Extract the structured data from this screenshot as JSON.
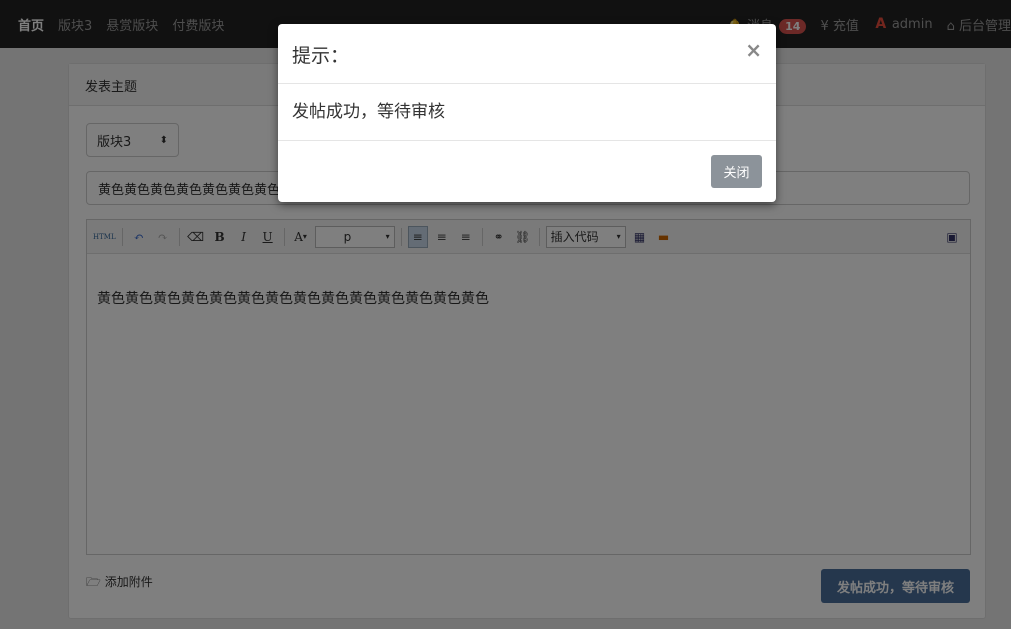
{
  "nav": {
    "home": "首页",
    "board3": "版块3",
    "reward": "悬赏版块",
    "paid": "付费版块",
    "messages": "消息",
    "message_count": "14",
    "recharge": "¥ 充值",
    "user": "admin",
    "admin": "后台管理"
  },
  "panel": {
    "heading": "发表主题",
    "board_select": "版块3",
    "title_value": "黄色黄色黄色黄色黄色黄色黄色黄色黄色黄色黄色黄色黄色黄色",
    "toolbar": {
      "html": "HTML",
      "bold": "B",
      "italic": "I",
      "underline": "U",
      "font_color": "A",
      "paragraph": "p",
      "insert_code": "插入代码"
    },
    "content": "黄色黄色黄色黄色黄色黄色黄色黄色黄色黄色黄色黄色黄色黄色",
    "attach": "添加附件",
    "submit": "发帖成功，等待审核"
  },
  "modal": {
    "title": "提示：",
    "close": "×",
    "message": "发帖成功，等待审核",
    "close_button": "关闭"
  }
}
